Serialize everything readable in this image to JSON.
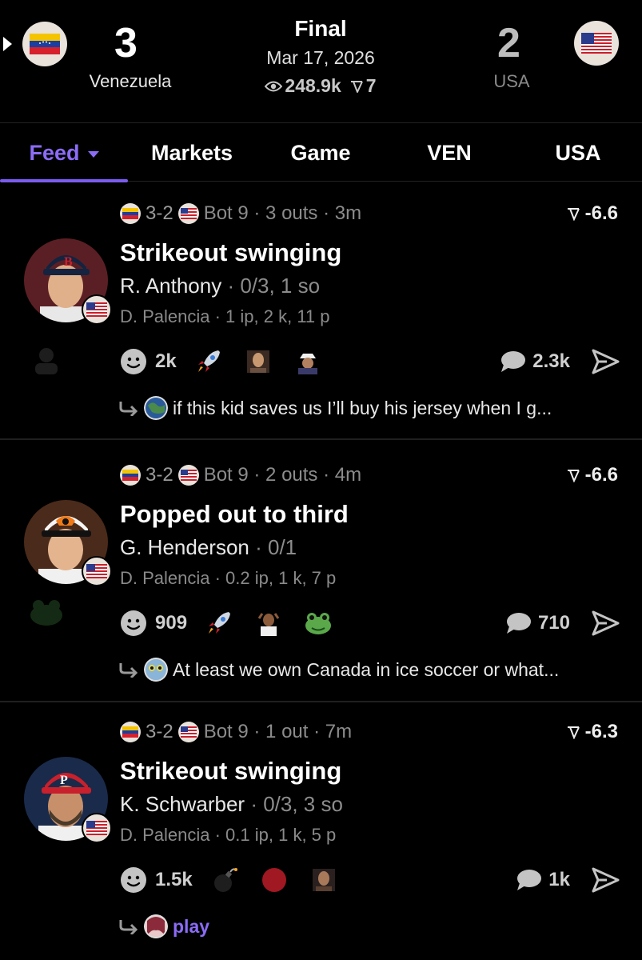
{
  "header": {
    "home": {
      "score": "3",
      "name": "Venezuela"
    },
    "away": {
      "score": "2",
      "name": "USA"
    },
    "status": "Final",
    "date": "Mar 17, 2026",
    "views": "248.9k",
    "bets": "7"
  },
  "tabs": [
    {
      "label": "Feed"
    },
    {
      "label": "Markets"
    },
    {
      "label": "Game"
    },
    {
      "label": "VEN"
    },
    {
      "label": "USA"
    }
  ],
  "feed": [
    {
      "score": "3-2",
      "inning": "Bot 9 · 3 outs · 3m",
      "line": "-6.6",
      "title": "Strikeout swinging",
      "batter_name": "R. Anthony",
      "batter_stats": "· 0/3, 1 so",
      "pitcher": "D. Palencia · 1 ip, 2 k, 11 p",
      "reactions": "2k",
      "comments": "2.3k",
      "reply": "if this kid saves us I’ll buy his jersey when I g..."
    },
    {
      "score": "3-2",
      "inning": "Bot 9 · 2 outs · 4m",
      "line": "-6.6",
      "title": "Popped out to third",
      "batter_name": "G. Henderson",
      "batter_stats": "· 0/1",
      "pitcher": "D. Palencia · 0.2 ip, 1 k, 7 p",
      "reactions": "909",
      "comments": "710",
      "reply": "At least we own Canada in ice soccer or what..."
    },
    {
      "score": "3-2",
      "inning": "Bot 9 · 1 out · 7m",
      "line": "-6.3",
      "title": "Strikeout swinging",
      "batter_name": "K. Schwarber",
      "batter_stats": "· 0/3, 3 so",
      "pitcher": "D. Palencia · 0.1 ip, 1 k, 5 p",
      "reactions": "1.5k",
      "comments": "1k",
      "reply": "play"
    }
  ],
  "colors": {
    "accent": "#8b6cf6",
    "background": "#000000"
  }
}
